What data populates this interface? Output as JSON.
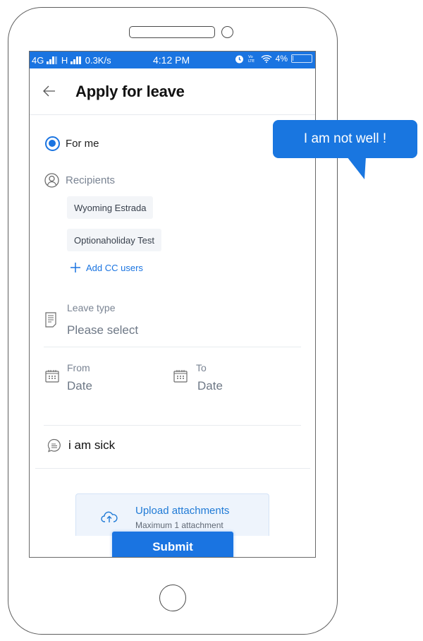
{
  "statusbar": {
    "network_1": "4G",
    "network_2": "H",
    "speed": "0.3K/s",
    "time": "4:12 PM",
    "volte": "Vo LTE",
    "battery": "4%"
  },
  "header": {
    "back_icon": "arrow-left-icon",
    "title": "Apply for leave"
  },
  "form": {
    "applicant_option": {
      "label": "For me",
      "selected": true
    },
    "recipients": {
      "label": "Recipients",
      "icon": "user-icon",
      "items": [
        "Wyoming Estrada",
        "Optionaholiday Test"
      ],
      "add_cc_label": "Add CC users"
    },
    "leave_type": {
      "label": "Leave type",
      "placeholder": "Please select",
      "icon": "document-icon"
    },
    "from_date": {
      "label": "From",
      "placeholder": "Date",
      "icon": "calendar-icon"
    },
    "to_date": {
      "label": "To",
      "placeholder": "Date",
      "icon": "calendar-icon"
    },
    "reason": {
      "value": "i am sick",
      "icon": "chat-icon"
    },
    "upload": {
      "title": "Upload attachments",
      "subtitle": "Maximum 1 attachment",
      "icon": "cloud-upload-icon"
    },
    "submit_label": "Submit"
  },
  "speech_bubble": {
    "text": "I am not well !"
  },
  "colors": {
    "primary": "#1a74e1",
    "muted_text": "#7a8493",
    "chip_bg": "#f3f5f8",
    "upload_bg": "#eef4fc"
  }
}
